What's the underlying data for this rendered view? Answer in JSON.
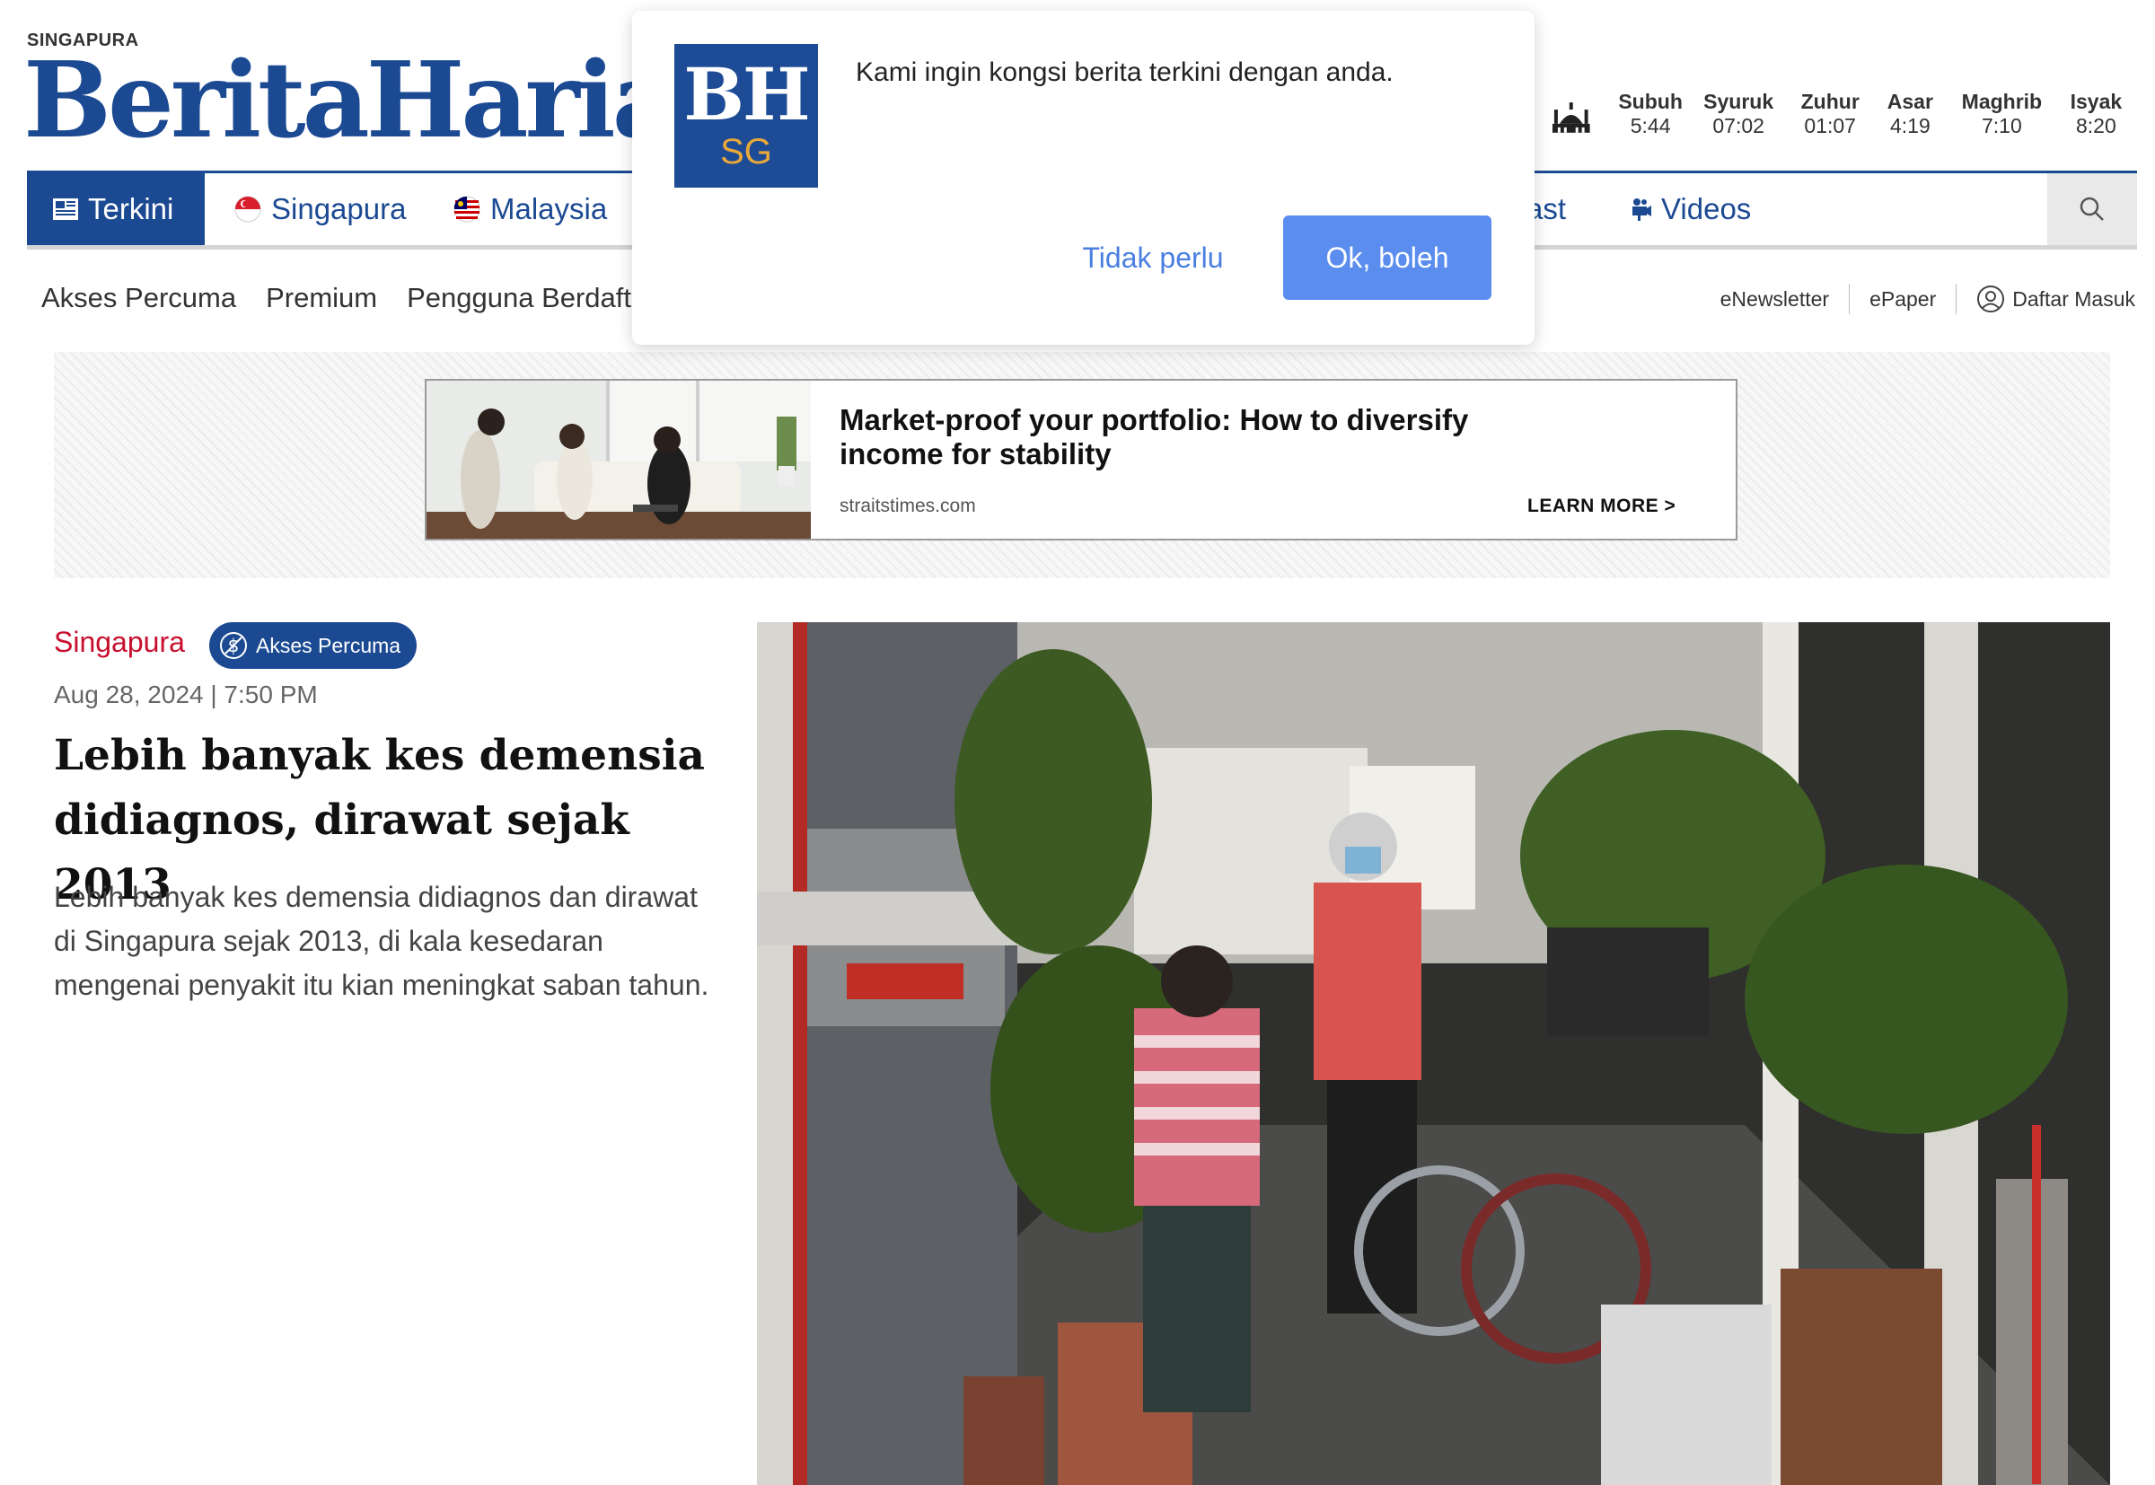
{
  "masthead": {
    "kicker": "SINGAPURA",
    "logo_text": "BeritaHarian"
  },
  "prayer_times": [
    {
      "name": "Subuh",
      "time": "5:44"
    },
    {
      "name": "Syuruk",
      "time": "07:02"
    },
    {
      "name": "Zuhur",
      "time": "01:07"
    },
    {
      "name": "Asar",
      "time": "4:19"
    },
    {
      "name": "Maghrib",
      "time": "7:10"
    },
    {
      "name": "Isyak",
      "time": "8:20"
    }
  ],
  "nav": {
    "items": [
      {
        "label": "Terkini",
        "icon": "newspaper-icon",
        "active": true
      },
      {
        "label": "Singapura",
        "icon": "singapore-flag-icon"
      },
      {
        "label": "Malaysia",
        "icon": "malaysia-flag-icon"
      },
      {
        "label": "ast",
        "icon": ""
      },
      {
        "label": "Videos",
        "icon": "video-camera-icon"
      }
    ],
    "search_icon": "search-icon"
  },
  "subnav": {
    "items": [
      "Akses Percuma",
      "Premium",
      "Pengguna Berdaft"
    ]
  },
  "utility": {
    "enewsletter": "eNewsletter",
    "epaper": "ePaper",
    "login": "Daftar Masuk"
  },
  "ad": {
    "title": "Market-proof your portfolio: How to diversify income for stability",
    "domain": "straitstimes.com",
    "cta": "LEARN MORE >"
  },
  "article": {
    "category": "Singapura",
    "badge": "Akses Percuma",
    "date": "Aug 28, 2024 | 7:50 PM",
    "headline": "Lebih banyak kes demensia didiagnos, dirawat sejak 2013",
    "summary": "Lebih banyak kes demensia didiagnos dan dirawat di Singapura sejak 2013, di kala kesedaran mengenai penyakit itu kian meningkat saban tahun."
  },
  "popup": {
    "logo_top": "BH",
    "logo_bottom": "SG",
    "message": "Kami ingin kongsi berita terkini dengan anda.",
    "deny_label": "Tidak perlu",
    "allow_label": "Ok, boleh"
  },
  "colors": {
    "brand_blue": "#1b4a93",
    "category_red": "#c8102e",
    "allow_button": "#5b8def"
  }
}
